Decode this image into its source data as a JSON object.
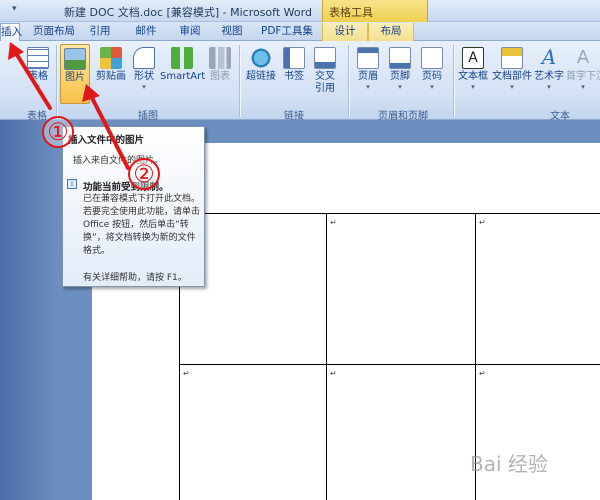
{
  "window": {
    "title": "新建 DOC 文档.doc [兼容模式] - Microsoft Word",
    "context_tab_group": "表格工具"
  },
  "tabs": [
    "插入",
    "页面布局",
    "引用",
    "邮件",
    "审阅",
    "视图",
    "PDF工具集",
    "设计",
    "布局"
  ],
  "ribbon": {
    "groups": {
      "tables": "表格",
      "illustrations": "插图",
      "links": "链接",
      "header_footer": "页眉和页脚",
      "text": "文本"
    },
    "buttons": {
      "table": "表格",
      "picture": "图片",
      "clipart": "剪贴画",
      "shapes": "形状",
      "smartart": "SmartArt",
      "chart": "图表",
      "hyperlink": "超链接",
      "bookmark": "书签",
      "crossref_1": "交叉",
      "crossref_2": "引用",
      "header": "页眉",
      "footer": "页脚",
      "pagenum": "页码",
      "textbox": "文本框",
      "quickparts": "文档部件",
      "wordart": "艺术字",
      "dropcap": "首字下沉"
    }
  },
  "tooltip": {
    "title": "插入文件中的图片",
    "subtitle": "插入来自文件的图片。",
    "warning_title": "功能当前受到限制。",
    "warning_body": "已在兼容模式下打开此文档。若要完全使用此功能，请单击 Office 按钮，然后单击“转换”，将文档转换为新的文件格式。",
    "help": "有关详细帮助，请按 F1。"
  },
  "annotations": {
    "marker_1": "①",
    "marker_2": "②"
  },
  "watermark": "Bai 经验",
  "colors": {
    "annotation": "#e01818",
    "ribbon": "#d3e1f4",
    "context_tab": "#f0cf51"
  }
}
